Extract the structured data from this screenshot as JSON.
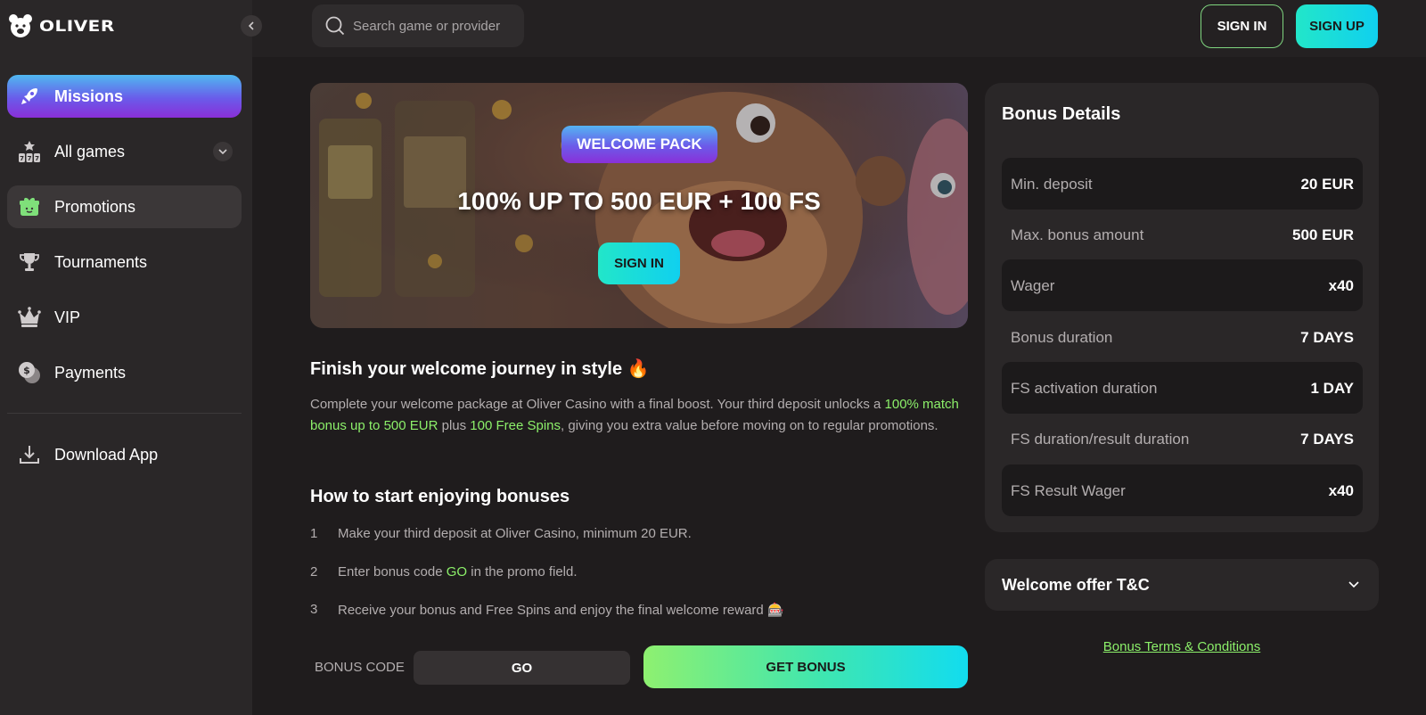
{
  "brand": {
    "name": "OLIVER"
  },
  "search": {
    "placeholder": "Search game or provider"
  },
  "header": {
    "signin_label": "SIGN IN",
    "signup_label": "SIGN UP"
  },
  "sidebar": {
    "items": [
      {
        "label": "Missions",
        "icon": "rocket-icon"
      },
      {
        "label": "All games",
        "icon": "slot-machine-icon"
      },
      {
        "label": "Promotions",
        "icon": "gift-icon"
      },
      {
        "label": "Tournaments",
        "icon": "trophy-icon"
      },
      {
        "label": "VIP",
        "icon": "crown-icon"
      },
      {
        "label": "Payments",
        "icon": "coins-icon"
      }
    ],
    "download_label": "Download App"
  },
  "banner": {
    "badge": "WELCOME PACK",
    "title": "100% UP TO 500 EUR + 100 FS",
    "signin_label": "SIGN IN"
  },
  "content": {
    "heading": "Finish your welcome journey in style",
    "heading_emoji": "🔥",
    "para_part1": "Complete your welcome package at Oliver Casino with a final boost. Your third deposit unlocks a ",
    "para_hl1": "100% match bonus up to 500 EUR",
    "para_part2": " plus ",
    "para_hl2": "100 Free Spins",
    "para_part3": ", giving you extra value before moving on to regular promotions.",
    "steps_heading": "How to start enjoying bonuses",
    "steps": [
      {
        "num": "1",
        "text": "Make your third deposit at Oliver Casino, minimum 20 EUR."
      },
      {
        "num": "2",
        "text_pre": "Enter bonus code ",
        "code": "GO",
        "text_post": " in the promo field."
      },
      {
        "num": "3",
        "text": "Receive your bonus and Free Spins and enjoy the final welcome reward",
        "emoji": "🎰"
      }
    ],
    "bonus_code_label": "BONUS CODE",
    "bonus_code_value": "GO",
    "get_bonus_label": "GET BONUS"
  },
  "details": {
    "title": "Bonus Details",
    "rows": [
      {
        "key": "Min. deposit",
        "value": "20 EUR"
      },
      {
        "key": "Max. bonus amount",
        "value": "500 EUR"
      },
      {
        "key": "Wager",
        "value": "x40"
      },
      {
        "key": "Bonus duration",
        "value": "7 DAYS"
      },
      {
        "key": "FS activation duration",
        "value": "1 DAY"
      },
      {
        "key": "FS duration/result duration",
        "value": "7 DAYS"
      },
      {
        "key": "FS Result Wager",
        "value": "x40"
      }
    ]
  },
  "tc": {
    "title": "Welcome offer T&C",
    "link": "Bonus Terms & Conditions"
  },
  "colors": {
    "accent_green": "#8cf06a",
    "accent_cyan": "#10d0ef",
    "accent_purple": "#6c5ae9"
  }
}
